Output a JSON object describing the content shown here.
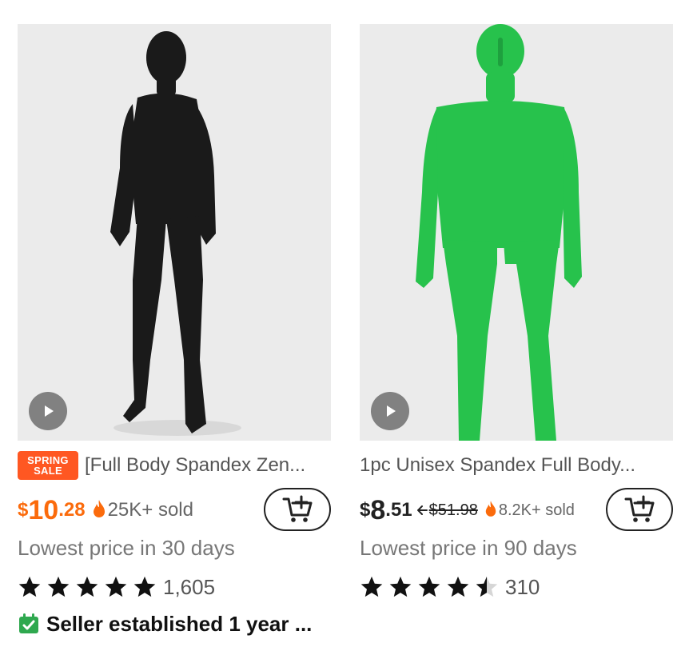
{
  "products": [
    {
      "badge": {
        "line1": "SPRING",
        "line2": "SALE"
      },
      "title": "[Full Body Spandex Zen...",
      "price": {
        "currency": "$",
        "integer": "10",
        "decimal": ".28"
      },
      "sold": "25K+ sold",
      "lowest_price_note": "Lowest price in 30 days",
      "rating": 5,
      "review_count": "1,605",
      "seller_note": "Seller established 1 year ...",
      "suit_color": "#1a1a1a"
    },
    {
      "title": "1pc Unisex Spandex Full Body...",
      "price": {
        "currency": "$",
        "integer": "8",
        "decimal": ".51"
      },
      "original_price": "$51.98",
      "sold": "8.2K+ sold",
      "lowest_price_note": "Lowest price in 90 days",
      "rating": 4.5,
      "review_count": "310",
      "suit_color": "#27c24c"
    }
  ],
  "colors": {
    "accent_orange": "#fb6b0c",
    "badge_red": "#ff5722",
    "seller_green": "#2fa84f"
  }
}
